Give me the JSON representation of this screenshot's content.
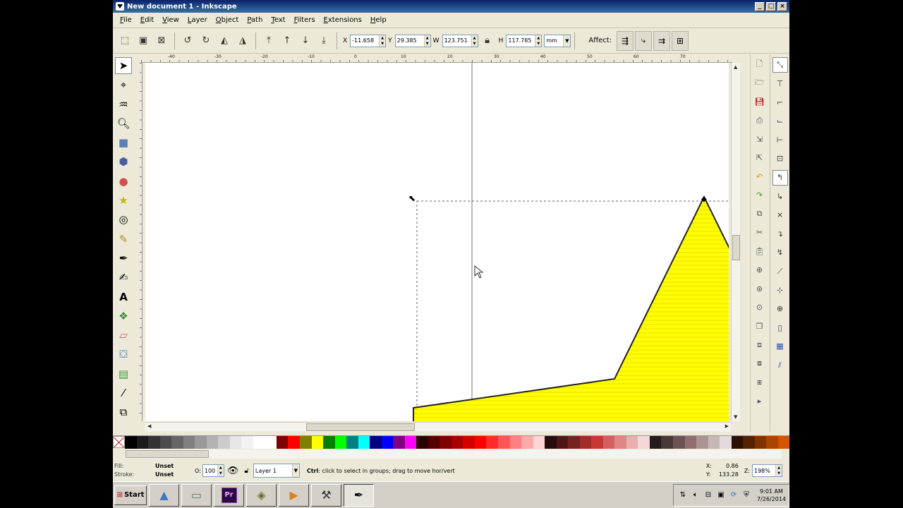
{
  "window": {
    "title": "New document 1 - Inkscape",
    "minimize": "_",
    "maximize": "□",
    "close": "×"
  },
  "menu": [
    "File",
    "Edit",
    "View",
    "Layer",
    "Object",
    "Path",
    "Text",
    "Filters",
    "Extensions",
    "Help"
  ],
  "controls": {
    "x_label": "X",
    "x_value": "-11.658",
    "y_label": "Y",
    "y_value": "29.385",
    "w_label": "W",
    "w_value": "123.751",
    "h_label": "H",
    "h_value": "117.785",
    "unit": "mm",
    "affect_label": "Affect:"
  },
  "ruler": {
    "ticks": [
      "-40",
      "-30",
      "-20",
      "-10",
      "0",
      "10",
      "20",
      "30",
      "40",
      "50",
      "60",
      "70"
    ]
  },
  "palette": {
    "colors": [
      "#000000",
      "#1a1a1a",
      "#333333",
      "#4d4d4d",
      "#666666",
      "#808080",
      "#999999",
      "#b3b3b3",
      "#cccccc",
      "#e6e6e6",
      "#f2f2f2",
      "#ffffff",
      "#ffffff",
      "#800000",
      "#ff0000",
      "#808000",
      "#ffff00",
      "#008000",
      "#00ff00",
      "#008080",
      "#00ffff",
      "#000080",
      "#0000ff",
      "#800080",
      "#ff00ff",
      "#2b0000",
      "#550000",
      "#800000",
      "#aa0000",
      "#d40000",
      "#ff0000",
      "#ff2a2a",
      "#ff5555",
      "#ff8080",
      "#ffaaaa",
      "#ffd5d5",
      "#280b0b",
      "#501616",
      "#782121",
      "#a02c2c",
      "#c83737",
      "#d35f5f",
      "#de8787",
      "#e9afaf",
      "#f4d7d7",
      "#241c1c",
      "#483737",
      "#6c5353",
      "#916f6f",
      "#ac9393",
      "#c8b7b7",
      "#e3dbdb",
      "#2b1100",
      "#552200",
      "#803300",
      "#aa4400",
      "#d45500"
    ],
    "fill_color": "#ffff00"
  },
  "status": {
    "fill_label": "Fill:",
    "fill_value": "Unset",
    "stroke_label": "Stroke:",
    "stroke_value": "Unset",
    "opacity_label": "O:",
    "opacity_value": "100",
    "layer": "Layer 1",
    "message_bold": "Ctrl",
    "message_rest": ": click to select in groups; drag to move hor/vert",
    "x_label": "X:",
    "x_value": "0.86",
    "y_label": "Y:",
    "y_value": "133.28",
    "zoom_label": "Z:",
    "zoom_value": "198%"
  },
  "taskbar": {
    "start_label": "Start",
    "premiere_label": "Pr",
    "clock_time": "9:01 AM",
    "clock_date": "7/26/2014"
  }
}
